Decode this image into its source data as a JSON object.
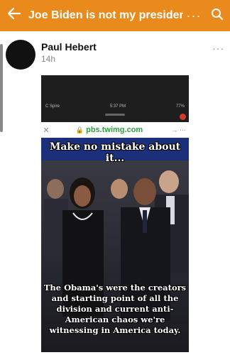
{
  "header": {
    "title": "Joe Biden is not my president",
    "more_label": "···",
    "back_icon": "arrow-left-icon",
    "search_icon": "search-icon",
    "bar_color": "#ea8a1c"
  },
  "post": {
    "author": "Paul Hebert",
    "time": "14h",
    "more_label": "···"
  },
  "screenshot": {
    "carrier": "C Spire",
    "clock": "5:37 PM",
    "battery": "77%",
    "url": "pbs.twimg.com",
    "close_label": "✕",
    "nav_label": "→ ···",
    "meme_top": "Make no mistake about it...",
    "meme_bottom": "The Obama's were the creators and starting point of all the division and current anti-American chaos we're witnessing in America today."
  }
}
